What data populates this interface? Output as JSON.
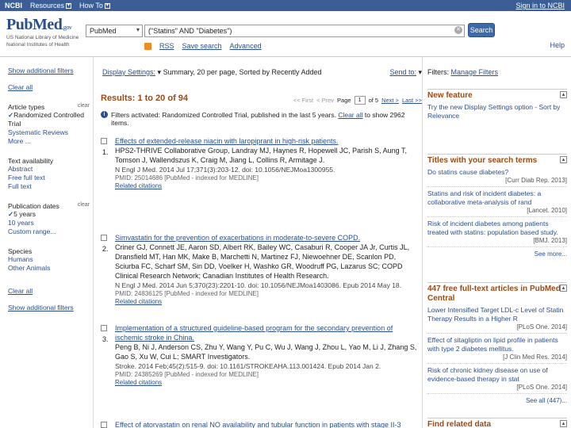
{
  "topbar": {
    "logo": "NCBI",
    "resources": "Resources",
    "howto": "How To",
    "signin": "Sign in to NCBI"
  },
  "header": {
    "logo_main": "PubMed",
    "logo_gov": ".gov",
    "logo_sub1": "US National Library of Medicine",
    "logo_sub2": "National Institutes of Health",
    "db_value": "PubMed",
    "search_value": "(\"Statins\" AND \"Diabetes\")",
    "search_label": "Search",
    "rss": "RSS",
    "save_search": "Save search",
    "advanced": "Advanced",
    "help": "Help"
  },
  "sidebar": {
    "show_filters_top": "Show additional filters",
    "clear_all": "Clear all",
    "groups": [
      {
        "title": "Article types",
        "clear": "clear",
        "options": [
          "Randomized Controlled Trial",
          "Systematic Reviews",
          "More ..."
        ],
        "selected": 0
      },
      {
        "title": "Text availability",
        "clear": "",
        "options": [
          "Abstract",
          "Free full text",
          "Full text"
        ],
        "selected": -1
      },
      {
        "title": "Publication dates",
        "clear": "clear",
        "options": [
          "5 years",
          "10 years",
          "Custom range..."
        ],
        "selected": 0
      },
      {
        "title": "Species",
        "clear": "",
        "options": [
          "Humans",
          "Other Animals"
        ],
        "selected": -1
      }
    ],
    "clear_all_bottom": "Clear all",
    "show_filters_bottom": "Show additional filters"
  },
  "main": {
    "display_settings": "Display Settings:",
    "display_value": "Summary, 20 per page, Sorted by Recently Added",
    "send_to": "Send to:",
    "results_title": "Results: 1 to 20 of 94",
    "pager": {
      "first": "<< First",
      "prev": "< Prev",
      "page_label": "Page",
      "page_value": "1",
      "of": "of 5",
      "next": "Next >",
      "last": "Last >>"
    },
    "filter_note_pre": "Filters activated: Randomized Controlled Trial, published in the last 5 years.",
    "filter_note_link": "Clear all",
    "filter_note_post": "to show 2962 items.",
    "results": [
      {
        "num": "1.",
        "title": "Effects of extended-release niacin with laropiprant in high-risk patients.",
        "authors": "HPS2-THRIVE Collaborative Group, Landray MJ, Haynes R, Hopewell JC, Parish S, Aung T, Tomson J, Wallendszus K, Craig M, Jiang L, Collins R, Armitage J.",
        "journal": "N Engl J Med. 2014 Jul 17;371(3):203-12. doi: 10.1056/NEJMoa1300955.",
        "pmid": "PMID: 25014686 [PubMed - indexed for MEDLINE]",
        "related": "Related citations"
      },
      {
        "num": "2.",
        "title": "Simvastatin for the prevention of exacerbations in moderate-to-severe COPD.",
        "authors": "Criner GJ, Connett JE, Aaron SD, Albert RK, Bailey WC, Casaburi R, Cooper JA Jr, Curtis JL, Dransfield MT, Han MK, Make B, Marchetti N, Martinez FJ, Niewoehner DE, Scanlon PD, Sciurba FC, Scharf SM, Sin DD, Voelker H, Washko GR, Woodruff PG, Lazarus SC; COPD Clinical Research Network; Canadian Institutes of Health Research.",
        "journal": "N Engl J Med. 2014 Jun 5;370(23):2201-10. doi: 10.1056/NEJMoa1403086. Epub 2014 May 18.",
        "pmid": "PMID: 24836125 [PubMed - indexed for MEDLINE]",
        "related": "Related citations"
      },
      {
        "num": "3.",
        "title": "Implementation of a structured guideline-based program for the secondary prevention of ischemic stroke in China.",
        "authors": "Peng B, Ni J, Anderson CS, Zhu Y, Wang Y, Pu C, Wu J, Wang J, Zhou L, Yao M, Li J, Zhang S, Gao S, Xu W, Cui L; SMART Investigators.",
        "journal": "Stroke. 2014 Feb;45(2):515-9. doi: 10.1161/STROKEAHA.113.001424. Epub 2014 Jan 2.",
        "pmid": "PMID: 24385269 [PubMed - indexed for MEDLINE]",
        "related": "Related citations"
      },
      {
        "num": "4.",
        "title": "Effect of atorvastatin on renal NO availability and tubular function in patients with stage II-3 chronic",
        "authors": "",
        "journal": "",
        "pmid": "",
        "related": ""
      }
    ]
  },
  "right": {
    "filters_label": "Filters:",
    "manage_filters": "Manage Filters",
    "new_feature": {
      "head": "New feature",
      "text": "Try the new Display Settings option - Sort by Relevance"
    },
    "titles": {
      "head": "Titles with your search terms",
      "items": [
        {
          "title": "Do statins cause diabetes?",
          "src": "[Curr Diab Rep. 2013]"
        },
        {
          "title": "Statins and risk of incident diabetes: a collaborative meta-analysis of rand",
          "src": "[Lancet. 2010]"
        },
        {
          "title": "Risk of incident diabetes among patients treated with statins: population based study.",
          "src": "[BMJ. 2013]"
        }
      ],
      "more": "See more..."
    },
    "free": {
      "head": "447 free full-text articles in PubMed Central",
      "items": [
        {
          "title": "Lower Intensified Target LDL-c Level of Statin Therapy Results in a Higher R",
          "src": "[PLoS One. 2014]"
        },
        {
          "title": "Effect of sitagliptin on lipid profile in patients with type 2 diabetes mellitus.",
          "src": "[J Clin Med Res. 2014]"
        },
        {
          "title": "Risk of chronic kidney disease on use of evidence-based therapy in stat",
          "src": "[PLoS One. 2014]"
        }
      ],
      "more": "See all (447)..."
    },
    "find_related": {
      "head": "Find related data"
    }
  }
}
